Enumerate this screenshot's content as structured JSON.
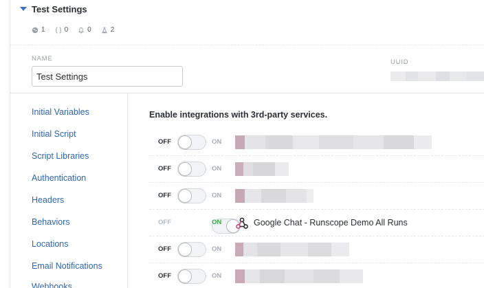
{
  "section": {
    "title": "Test Settings",
    "stats": [
      {
        "icon": "globe-icon",
        "value": "1"
      },
      {
        "icon": "braces-icon",
        "value": "0"
      },
      {
        "icon": "bell-icon",
        "value": "0"
      },
      {
        "icon": "flask-icon",
        "value": "2"
      }
    ]
  },
  "form": {
    "name_label": "NAME",
    "name_value": "Test Settings",
    "uuid_label": "UUID"
  },
  "sidebar": {
    "items": [
      {
        "label": "Initial Variables"
      },
      {
        "label": "Initial Script"
      },
      {
        "label": "Script Libraries"
      },
      {
        "label": "Authentication"
      },
      {
        "label": "Headers"
      },
      {
        "label": "Behaviors"
      },
      {
        "label": "Locations"
      },
      {
        "label": "Email Notifications"
      },
      {
        "label": "Webhooks"
      }
    ]
  },
  "integrations": {
    "heading": "Enable integrations with 3rd-party services.",
    "off_label": "OFF",
    "on_label": "ON",
    "rows": [
      {
        "enabled": false,
        "name": null
      },
      {
        "enabled": false,
        "name": null
      },
      {
        "enabled": false,
        "name": null
      },
      {
        "enabled": true,
        "name": "Google Chat - Runscope Demo All Runs",
        "icon": "webhook-icon"
      },
      {
        "enabled": false,
        "name": null
      },
      {
        "enabled": false,
        "name": null
      }
    ]
  },
  "colors": {
    "link": "#2f66b3",
    "on_green": "#3aa548",
    "caret": "#3b72c4"
  }
}
